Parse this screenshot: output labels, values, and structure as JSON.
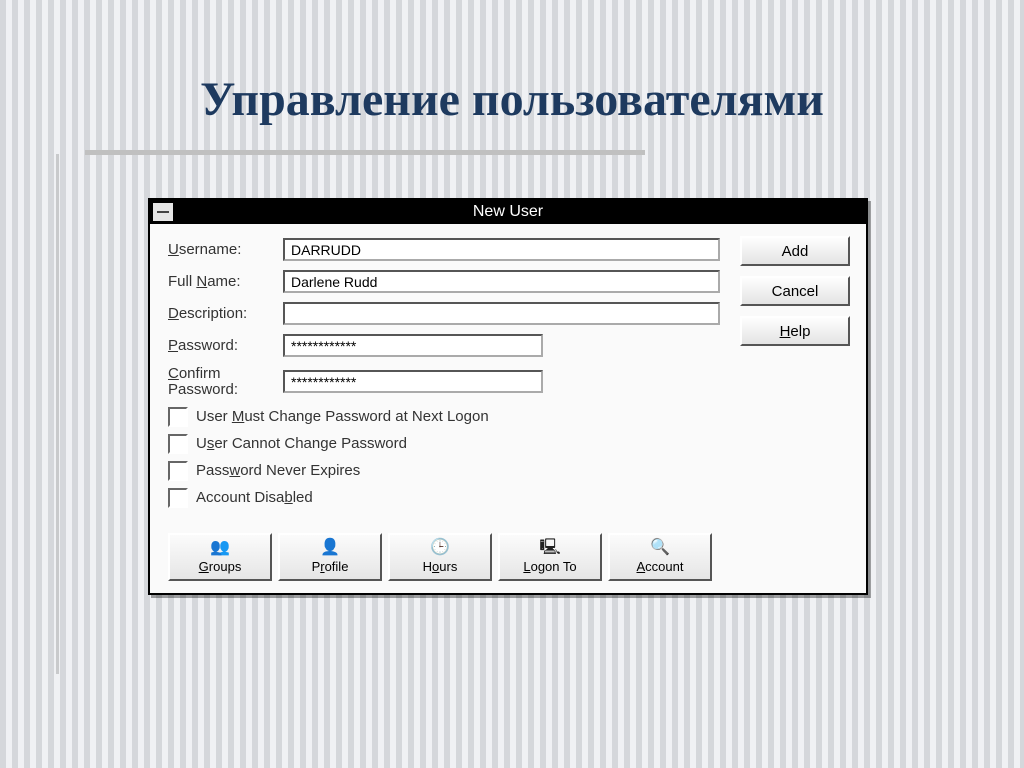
{
  "slide": {
    "title": "Управление пользователями"
  },
  "dialog": {
    "title": "New User",
    "fields": {
      "username": {
        "label": "Username:",
        "value": "DARRUDD"
      },
      "fullname": {
        "label": "Full Name:",
        "value": "Darlene Rudd"
      },
      "desc": {
        "label": "Description:",
        "value": ""
      },
      "password": {
        "label": "Password:",
        "value": "************"
      },
      "confirm": {
        "label1": "Confirm",
        "label2": "Password:",
        "value": "************"
      }
    },
    "buttons": {
      "add": "Add",
      "cancel": "Cancel",
      "help": "Help"
    },
    "checks": {
      "mustchange": "User Must Change Password at Next Logon",
      "cannot": "User Cannot Change Password",
      "neverexp": "Password Never Expires",
      "disabled": "Account Disabled"
    },
    "toolbar": {
      "groups": "Groups",
      "profile": "Profile",
      "hours": "Hours",
      "logonto": "Logon To",
      "account": "Account"
    }
  }
}
